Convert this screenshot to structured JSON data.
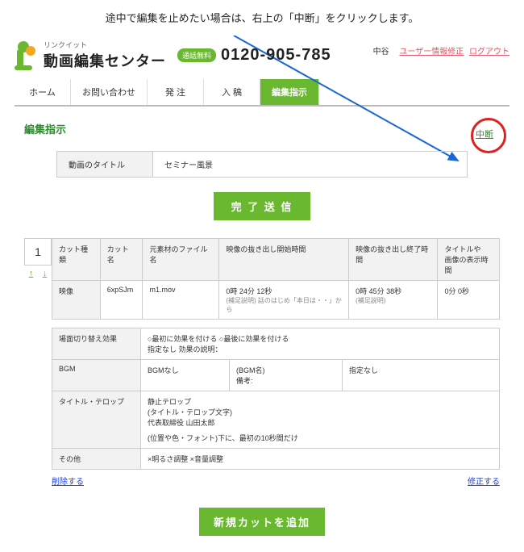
{
  "note": "途中で編集を止めたい場合は、右上の「中断」をクリックします。",
  "brand": {
    "sub": "リンクイット",
    "main": "動画編集センター",
    "tel_badge": "通話無料",
    "tel": "0120-905-785"
  },
  "user": {
    "name": "中谷",
    "edit_link": "ユーザー情報修正",
    "logout": "ログアウト"
  },
  "nav": [
    "ホーム",
    "お問い合わせ",
    "発 注",
    "入 稿",
    "編集指示"
  ],
  "nav_active": 4,
  "section_title": "編集指示",
  "cancel": "中断",
  "title_field": {
    "label": "動画のタイトル",
    "value": "セミナー風景"
  },
  "submit_btn": "完 了 送 信",
  "cut": {
    "num": "1",
    "up": "↑",
    "down": "↓",
    "headers": [
      "カット種類",
      "カット名",
      "元素材のファイル名",
      "映像の抜き出し開始時間",
      "映像の抜き出し終了時間",
      "タイトルや\n画像の表示時間"
    ],
    "row": {
      "type": "映像",
      "name": "6xpSJm",
      "file": "m1.mov",
      "start": "0時 24分 12秒",
      "start_note": "(補足説明) 話のはじめ「本日は・・」から",
      "end": "0時 45分 38秒",
      "end_note": "(補足説明)",
      "duration": "0分 0秒"
    }
  },
  "details": {
    "scene": {
      "label": "場面切り替え効果",
      "val1": "○最初に効果を付ける ○最後に効果を付ける",
      "val2": "指定なし 効果の説明："
    },
    "bgm": {
      "label": "BGM",
      "val": "BGMなし",
      "name_label": "(BGM名)",
      "note_label": "備考:",
      "spec": "指定なし"
    },
    "telop": {
      "label": "タイトル・テロップ",
      "l1": "静止テロップ",
      "l2": "(タイトル・テロップ文字)",
      "l3": "代表取締役 山田太郎",
      "l4": "(位置や色・フォント)下に、最初の10秒間だけ"
    },
    "other": {
      "label": "その他",
      "val": "×明るさ調整 ×音量調整"
    }
  },
  "bottom": {
    "delete": "削除する",
    "edit": "修正する"
  },
  "add_btn": "新規カットを追加"
}
